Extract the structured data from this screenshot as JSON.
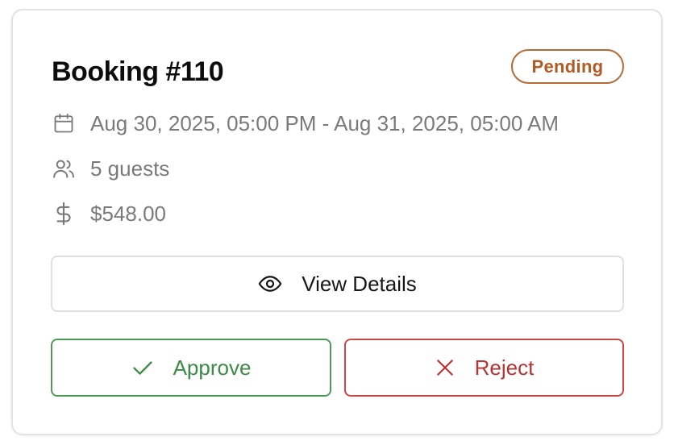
{
  "booking": {
    "title": "Booking #110",
    "status": "Pending",
    "date_range": "Aug 30, 2025, 05:00 PM - Aug 31, 2025, 05:00 AM",
    "guests": "5 guests",
    "price": "$548.00"
  },
  "actions": {
    "view_label": "View Details",
    "approve_label": "Approve",
    "reject_label": "Reject"
  },
  "icons": {
    "date": "calendar-icon",
    "guests": "users-icon",
    "price": "dollar-icon",
    "view": "eye-icon",
    "approve": "check-icon",
    "reject": "x-icon"
  },
  "colors": {
    "pending_badge": "#b25a24",
    "approve": "#3c8a45",
    "reject": "#b83232",
    "muted_text": "#7a7a7a"
  }
}
